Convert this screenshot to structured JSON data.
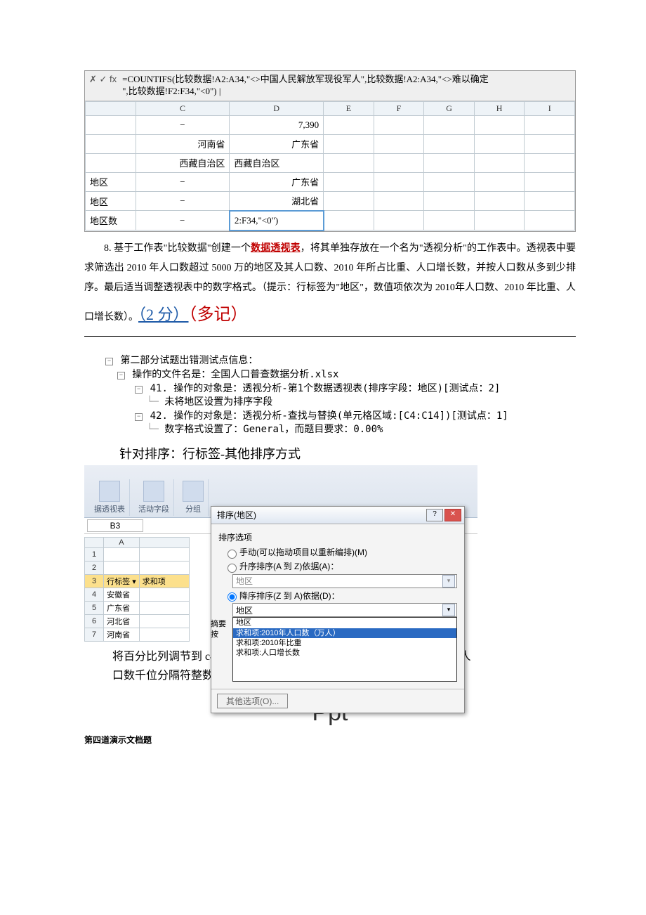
{
  "formula_bar": {
    "buttons": "✗ ✓ fx",
    "formula_line1": "=COUNTIFS(比较数据!A2:A34,\"<>中国人民解放军现役军人\",比较数据!A2:A34,\"<>难以确定",
    "formula_line2": "\",比较数据!F2:F34,\"<0\")  |"
  },
  "excel_grid": {
    "col_headers": [
      "C",
      "D",
      "E",
      "F",
      "G",
      "H",
      "I"
    ],
    "row_partials": [
      "",
      "",
      "",
      "地区",
      "地区",
      "地区数"
    ],
    "rows": [
      {
        "c": "−",
        "d": "7,390"
      },
      {
        "c": "河南省",
        "d": "广东省"
      },
      {
        "c": "西藏自治区",
        "d": "西藏自治区"
      },
      {
        "c": "−",
        "d": "广东省"
      },
      {
        "c": "−",
        "d": "湖北省"
      },
      {
        "c": "−",
        "d": "2:F34,\"<0\")"
      }
    ]
  },
  "para1": {
    "prefix": "8. 基于工作表\"比较数据\"创建一个",
    "pivot_link": "数据透视表",
    "rest": "，将其单独存放在一个名为\"透视分析\"的工作表中。透视表中要求筛选出 2010 年人口数超过 5000 万的地区及其人口数、2010 年所占比重、人口增长数，并按人口数从多到少排序。最后适当调整透视表中的数字格式。（提示：行标签为\"地区\"，数值项依次为 2010年人口数、2010 年比重、人口增长数）。",
    "score": "（2 分）",
    "note": "（多记）"
  },
  "tree": {
    "l1": "第二部分试题出错测试点信息：",
    "l2": "操作的文件名是：全国人口普查数据分析.xlsx",
    "l3": "41. 操作的对象是：透视分析-第1个数据透视表(排序字段：地区)[测试点：2]",
    "l4": "未将地区设置为排序字段",
    "l5": "42. 操作的对象是：透视分析-查找与替换(单元格区域:[C4:C14])[测试点：1]",
    "l6": "数字格式设置了：General，而题目要求：0.00%"
  },
  "subheading1": "针对排序：行标签-其他排序方式",
  "ribbon": {
    "g1": "据透视表",
    "g2": "活动字段",
    "g3": "分组"
  },
  "name_box": "B3",
  "sheet": {
    "row_header_col": "A",
    "label_row": "行标签",
    "label_sum": "求和项",
    "provinces": [
      "安徽省",
      "广东省",
      "河北省",
      "河南省"
    ]
  },
  "dialog": {
    "title": "排序(地区)",
    "help_btn": "?",
    "close_btn": "✕",
    "group_label": "排序选项",
    "opt_manual": "手动(可以拖动项目以重新编排)(M)",
    "opt_asc": "升序排序(A 到 Z)依据(A)：",
    "combo_asc": "地区",
    "opt_desc": "降序排序(Z 到 A)依据(D)：",
    "combo_desc": "地区",
    "side_label1": "摘要",
    "side_label2": "按",
    "list_items": [
      "地区",
      "求和项:2010年人口数（万人）",
      "求和项:2010年比重",
      "求和项:人口增长数"
    ],
    "btn_more": "其他选项(O)..."
  },
  "para2": {
    "l1": "将百分比列调节到 c4:c14 列，2010 比重列设置百分比格式。设置 2010 人",
    "l2": "口数千位分隔符整数。"
  },
  "ppt_title": "Ppt",
  "q_title": "第四道演示文档题"
}
